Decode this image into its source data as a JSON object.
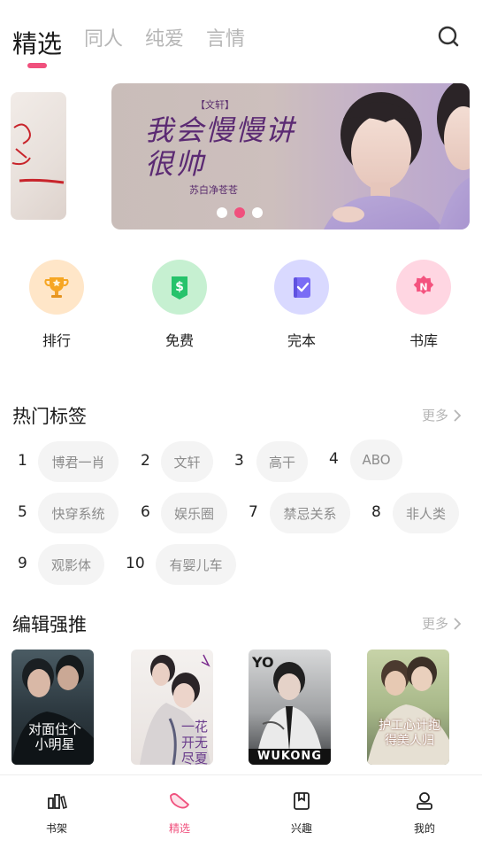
{
  "top_tabs": [
    {
      "label": "精选",
      "active": true
    },
    {
      "label": "同人",
      "active": false
    },
    {
      "label": "纯爱",
      "active": false
    },
    {
      "label": "言情",
      "active": false
    }
  ],
  "banner": {
    "tag": "【文轩】",
    "title": "我会慢慢讲很帅",
    "author": "苏白净苍苍",
    "slide_count": 3,
    "active_slide": 2
  },
  "quick_entries": [
    {
      "label": "排行",
      "icon": "trophy-icon",
      "color": "#ffe3c2"
    },
    {
      "label": "免费",
      "icon": "free-coupon-icon",
      "color": "#c9f1d3"
    },
    {
      "label": "完本",
      "icon": "completed-book-icon",
      "color": "#dcdcff"
    },
    {
      "label": "书库",
      "icon": "library-icon",
      "color": "#ffd8e3"
    }
  ],
  "hot_tags": {
    "title": "热门标签",
    "more": "更多",
    "items": [
      {
        "num": "1",
        "label": "博君一肖"
      },
      {
        "num": "2",
        "label": "文轩"
      },
      {
        "num": "3",
        "label": "高干"
      },
      {
        "num": "4",
        "label": "ABO"
      },
      {
        "num": "5",
        "label": "快穿系统"
      },
      {
        "num": "6",
        "label": "娱乐圈"
      },
      {
        "num": "7",
        "label": "禁忌关系"
      },
      {
        "num": "8",
        "label": "非人类"
      },
      {
        "num": "9",
        "label": "观影体"
      },
      {
        "num": "10",
        "label": "有婴儿车"
      }
    ]
  },
  "editor_picks": {
    "title": "编辑强推",
    "more": "更多",
    "books": [
      {
        "cover_text": "对面住个小明星"
      },
      {
        "cover_text": "一花开无尽夏"
      },
      {
        "cover_text": "WUKONG"
      },
      {
        "cover_text": "护工心计抱得美人归"
      }
    ]
  },
  "bottom_nav": [
    {
      "label": "书架",
      "icon": "bookshelf-icon",
      "active": false
    },
    {
      "label": "精选",
      "icon": "featured-icon",
      "active": true
    },
    {
      "label": "兴趣",
      "icon": "interest-icon",
      "active": false
    },
    {
      "label": "我的",
      "icon": "profile-icon",
      "active": false
    }
  ],
  "colors": {
    "accent": "#f0507d",
    "muted": "#b6b6b6",
    "chip_bg": "#f4f4f4"
  }
}
